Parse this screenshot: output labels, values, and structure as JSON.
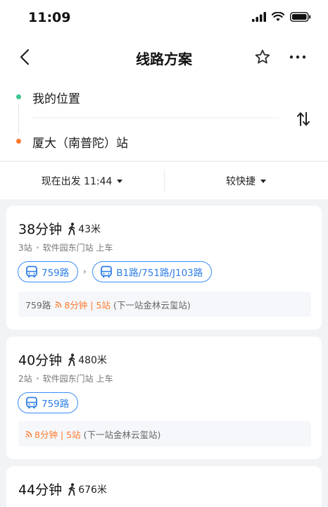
{
  "status": {
    "time": "11:09"
  },
  "header": {
    "title": "线路方案"
  },
  "route": {
    "from": "我的位置",
    "to": "厦大（南普陀）站"
  },
  "filters": {
    "depart": "现在出发 11:44",
    "sort": "较快捷"
  },
  "plans": [
    {
      "duration": "38分钟",
      "walk": "43米",
      "stops": "3站",
      "board": "软件园东门站 上车",
      "lines": [
        "759路",
        "B1路/751路/J103路"
      ],
      "info_line": "759路",
      "info_realtime": "8分钟 | 5站",
      "info_next": "(下一站金林云玺站)"
    },
    {
      "duration": "40分钟",
      "walk": "480米",
      "stops": "2站",
      "board": "软件园东门站 上车",
      "lines": [
        "759路"
      ],
      "info_realtime": "8分钟 | 5站",
      "info_next": "(下一站金林云玺站)"
    },
    {
      "duration": "44分钟",
      "walk": "676米"
    }
  ],
  "colors": {
    "accent_blue": "#2f7fe8",
    "realtime_orange": "#ff7a2e",
    "origin_green": "#3fc48f"
  }
}
